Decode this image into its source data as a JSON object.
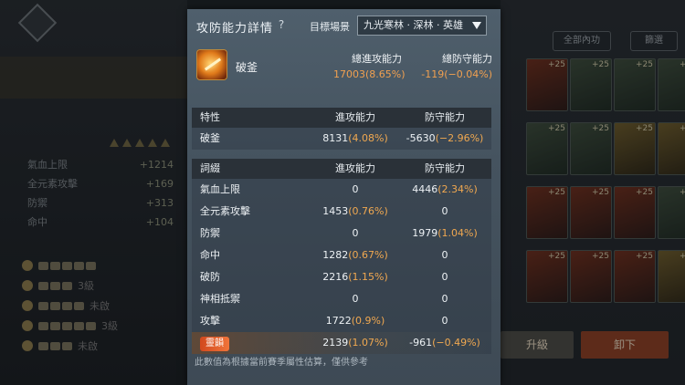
{
  "dialog": {
    "title": "攻防能力詳情",
    "help_symbol": "?",
    "target_label": "目標場景",
    "target_value": "九光寒林 · 深林 · 英雄",
    "skill": {
      "name": "破釜",
      "total_attack_label": "總進攻能力",
      "total_attack_value": "17003",
      "total_attack_pct": "(8.65%)",
      "total_defense_label": "總防守能力",
      "total_defense_value": "-119",
      "total_defense_pct": "(−0.04%)"
    },
    "traits_table": {
      "headers": [
        "特性",
        "進攻能力",
        "防守能力"
      ],
      "rows": [
        {
          "name": "破釜",
          "attack": "8131",
          "attack_pct": "(4.08%)",
          "defense": "-5630",
          "defense_pct": "(−2.96%)"
        }
      ]
    },
    "entries_table": {
      "headers": [
        "詞綴",
        "進攻能力",
        "防守能力"
      ],
      "rows": [
        {
          "name": "氣血上限",
          "attack": "0",
          "attack_pct": "",
          "defense": "4446",
          "defense_pct": "(2.34%)"
        },
        {
          "name": "全元素攻擊",
          "attack": "1453",
          "attack_pct": "(0.76%)",
          "defense": "0",
          "defense_pct": ""
        },
        {
          "name": "防禦",
          "attack": "0",
          "attack_pct": "",
          "defense": "1979",
          "defense_pct": "(1.04%)"
        },
        {
          "name": "命中",
          "attack": "1282",
          "attack_pct": "(0.67%)",
          "defense": "0",
          "defense_pct": ""
        },
        {
          "name": "破防",
          "attack": "2216",
          "attack_pct": "(1.15%)",
          "defense": "0",
          "defense_pct": ""
        },
        {
          "name": "神相抵禦",
          "attack": "0",
          "attack_pct": "",
          "defense": "0",
          "defense_pct": ""
        },
        {
          "name": "攻擊",
          "attack": "1722",
          "attack_pct": "(0.9%)",
          "defense": "0",
          "defense_pct": ""
        },
        {
          "name": "靈韻",
          "attack": "2139",
          "attack_pct": "(1.07%)",
          "defense": "-961",
          "defense_pct": "(−0.49%)",
          "highlight": true
        }
      ]
    },
    "footnote": "此數值為根據當前賽季屬性估算，僅供參考"
  },
  "background": {
    "filter_all": "全部內功",
    "filter_btn": "篩選",
    "upgrade_btn": "升級",
    "unload_btn": "卸下",
    "stat_rows": [
      {
        "label": "氣血上限",
        "value": "+1214"
      },
      {
        "label": "全元素攻擊",
        "value": "+169"
      },
      {
        "label": "防禦",
        "value": "+313"
      },
      {
        "label": "命中",
        "value": "+104"
      }
    ],
    "side_numbers": [
      "3級",
      "未啟",
      "3級",
      "未啟"
    ],
    "item_plus": "+25",
    "colors": {
      "accent_orange": "#f0a850",
      "tag_red": "#e05a2a",
      "dialog_bg": "#4a5866"
    }
  }
}
